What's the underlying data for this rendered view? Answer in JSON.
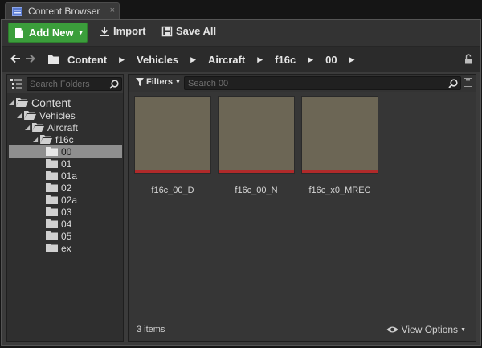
{
  "tab": {
    "title": "Content Browser",
    "close": "×"
  },
  "toolbar": {
    "add_new": "Add New",
    "import": "Import",
    "save_all": "Save All"
  },
  "breadcrumb": [
    "Content",
    "Vehicles",
    "Aircraft",
    "f16c",
    "00"
  ],
  "sources": {
    "search_placeholder": "Search Folders",
    "tree": [
      {
        "label": "Content",
        "expanded": true
      },
      {
        "label": "Vehicles",
        "expanded": true
      },
      {
        "label": "Aircraft",
        "expanded": true
      },
      {
        "label": "f16c",
        "expanded": true
      },
      {
        "label": "00",
        "selected": true
      },
      {
        "label": "01"
      },
      {
        "label": "01a"
      },
      {
        "label": "02"
      },
      {
        "label": "02a"
      },
      {
        "label": "03"
      },
      {
        "label": "04"
      },
      {
        "label": "05"
      },
      {
        "label": "ex"
      }
    ]
  },
  "assets": {
    "filters_label": "Filters",
    "search_placeholder": "Search 00",
    "items": [
      {
        "name": "f16c_00_D",
        "thumb_color": "#6c6655",
        "type_color": "#b02a2a"
      },
      {
        "name": "f16c_00_N",
        "thumb_color": "#6c6655",
        "type_color": "#b02a2a"
      },
      {
        "name": "f16c_x0_MREC",
        "thumb_color": "#6c6655",
        "type_color": "#b02a2a"
      }
    ],
    "count": "3 items",
    "view_options": "View Options"
  },
  "colors": {
    "accent_green": "#3b9e3b",
    "selection": "#8f8f8f",
    "folder": "#c8c8c8"
  }
}
